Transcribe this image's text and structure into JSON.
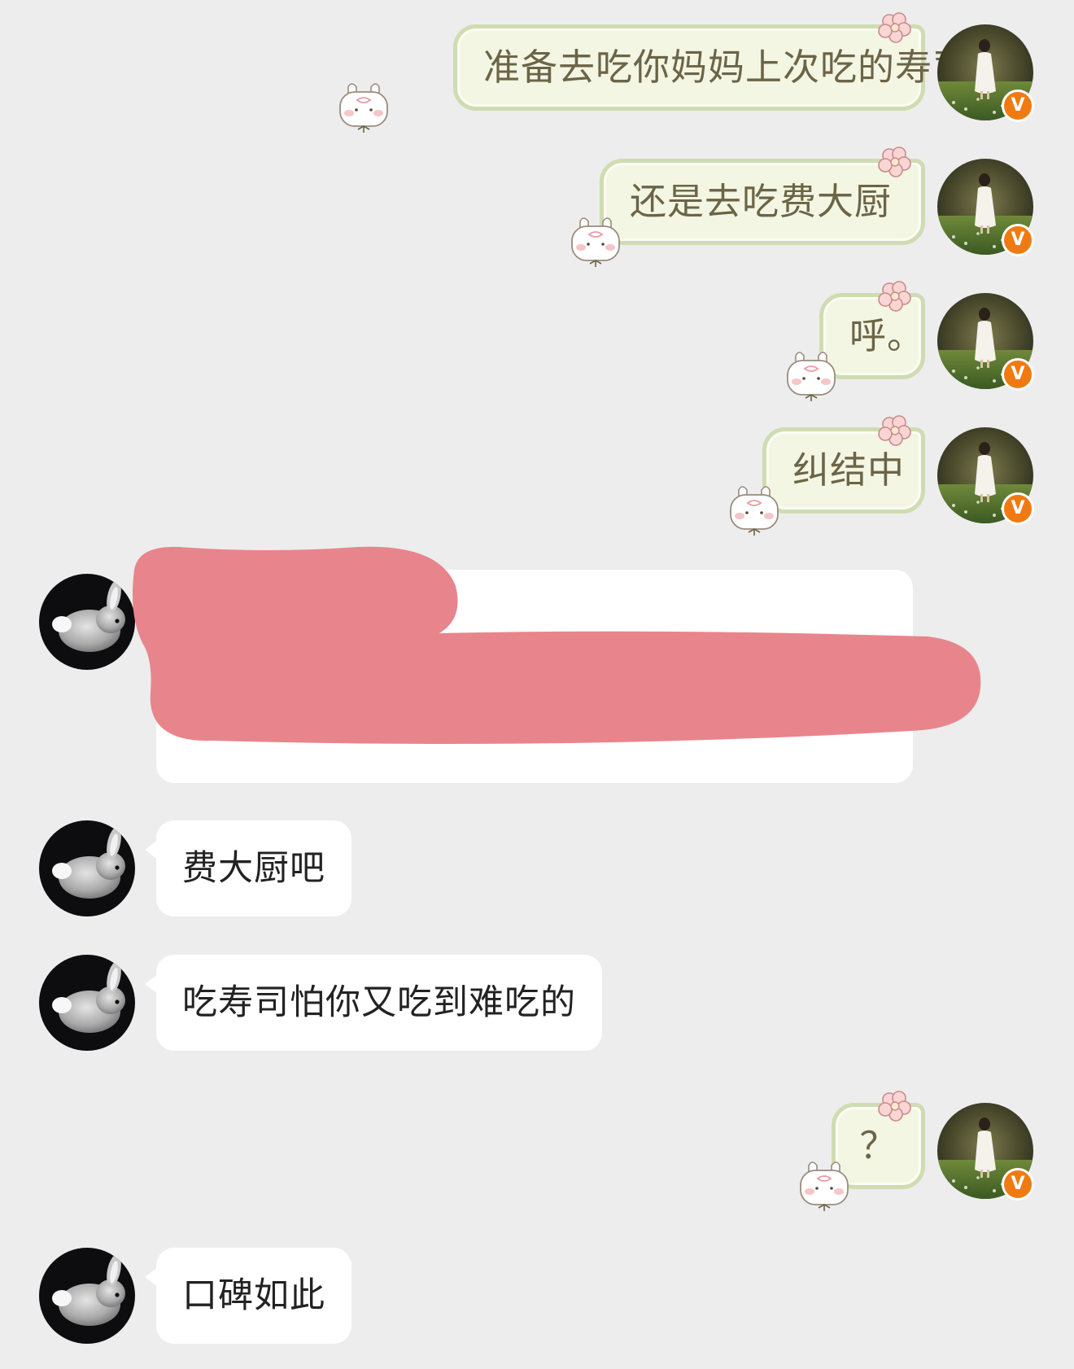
{
  "messages": [
    {
      "side": "out",
      "text": "准备去吃你妈妈上次吃的寿司"
    },
    {
      "side": "out",
      "text": "还是去吃费大厨"
    },
    {
      "side": "out",
      "text": "呼。"
    },
    {
      "side": "out",
      "text": "纠结中"
    },
    {
      "side": "in",
      "text": "",
      "redacted": true
    },
    {
      "side": "in",
      "text": "费大厨吧"
    },
    {
      "side": "in",
      "text": "吃寿司怕你又吃到难吃的"
    },
    {
      "side": "out",
      "text": "？"
    },
    {
      "side": "in",
      "text": "口碑如此"
    }
  ],
  "self_avatar": {
    "badge_text": "V",
    "badge_color": "#f07a12",
    "icon": "girl-in-field-avatar"
  },
  "peer_avatar": {
    "icon": "gray-bunny-avatar"
  },
  "colors": {
    "background": "#ededed",
    "out_bubble_fill": "#f3f6e2",
    "out_bubble_border": "#cfdcb2",
    "in_bubble_fill": "#ffffff",
    "redaction": "#e8858c"
  }
}
